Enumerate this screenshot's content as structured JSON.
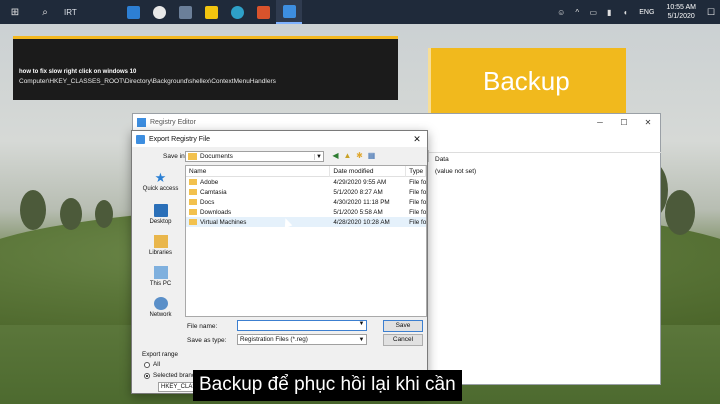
{
  "taskbar": {
    "search_text": "IRT",
    "clock_time": "10:55 AM",
    "clock_date": "5/1/2020",
    "language": "ENG",
    "apps": [
      {
        "name": "app-icon-vscode",
        "color": "#2d7fd3"
      },
      {
        "name": "app-icon-github",
        "color": "#e8e8e8"
      },
      {
        "name": "app-icon-media",
        "color": "#6b7f99"
      },
      {
        "name": "app-icon-sticky",
        "color": "#f1c40f"
      },
      {
        "name": "app-icon-edge",
        "color": "#2ea0c8"
      },
      {
        "name": "app-icon-camtasia",
        "color": "#d9532c"
      },
      {
        "name": "app-icon-regedit",
        "color": "#3d8ee0"
      }
    ]
  },
  "title_card": {
    "line1": "how to fix slow right click on windows 10",
    "line2": "Computer\\HKEY_CLASSES_ROOT\\Directory\\Background\\shellex\\ContextMenuHandlers"
  },
  "backup_card": {
    "text": "Backup"
  },
  "regedit": {
    "title": "Registry Editor",
    "data_header": "Data",
    "data_value": "(value not set)"
  },
  "dialog": {
    "title": "Export Registry File",
    "save_in_label": "Save in:",
    "save_in_value": "Documents",
    "places": [
      "Quick access",
      "Desktop",
      "Libraries",
      "This PC",
      "Network"
    ],
    "columns": {
      "name": "Name",
      "date": "Date modified",
      "type": "Type"
    },
    "files": [
      {
        "name": "Adobe",
        "date": "4/29/2020 9:55 AM",
        "type": "File fo"
      },
      {
        "name": "Camtasia",
        "date": "5/1/2020 8:27 AM",
        "type": "File fo"
      },
      {
        "name": "Docs",
        "date": "4/30/2020 11:18 PM",
        "type": "File fo"
      },
      {
        "name": "Downloads",
        "date": "5/1/2020 5:58 AM",
        "type": "File fo"
      },
      {
        "name": "Virtual Machines",
        "date": "4/28/2020 10:28 AM",
        "type": "File fo"
      }
    ],
    "file_name_label": "File name:",
    "file_name_value": "",
    "save_as_label": "Save as type:",
    "save_as_value": "Registration Files (*.reg)",
    "save_button": "Save",
    "cancel_button": "Cancel",
    "export_range_label": "Export range",
    "range_all": "All",
    "range_selected": "Selected branch",
    "branch_value": "HKEY_CLASSES_"
  },
  "subtitle": "Backup để phục hồi lại khi cần"
}
